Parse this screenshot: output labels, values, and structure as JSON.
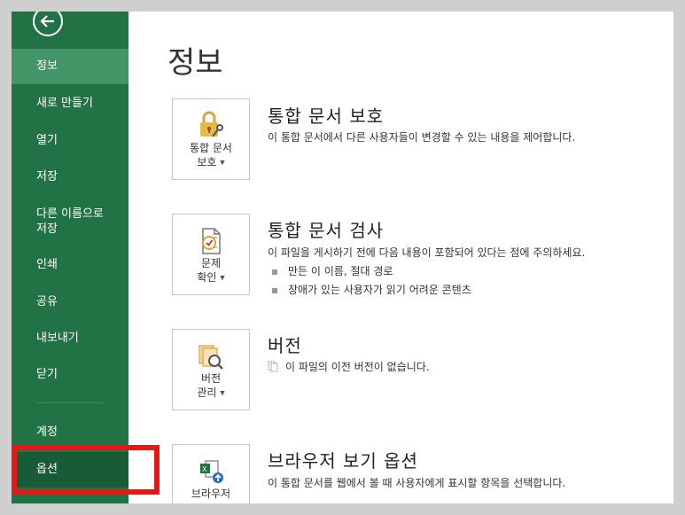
{
  "sidebar": {
    "items": [
      {
        "label": "정보"
      },
      {
        "label": "새로 만들기"
      },
      {
        "label": "열기"
      },
      {
        "label": "저장"
      },
      {
        "label": "다른 이름으로\n저장"
      },
      {
        "label": "인쇄"
      },
      {
        "label": "공유"
      },
      {
        "label": "내보내기"
      },
      {
        "label": "닫기"
      },
      {
        "label": "계정"
      },
      {
        "label": "옵션"
      }
    ]
  },
  "main": {
    "title": "정보",
    "sections": [
      {
        "button_label_1": "통합 문서",
        "button_label_2": "보호",
        "title": "통합 문서 보호",
        "desc": "이 통합 문서에서 다른 사용자들이 변경할 수 있는 내용을 제어합니다."
      },
      {
        "button_label_1": "문제",
        "button_label_2": "확인",
        "title": "통합 문서 검사",
        "desc": "이 파일을 게시하기 전에 다음 내용이 포함되어 있다는 점에 주의하세요.",
        "bullets": [
          "만든 이 이름, 절대 경로",
          "장애가 있는 사용자가 읽기 어려운 콘텐츠"
        ]
      },
      {
        "button_label_1": "버전",
        "button_label_2": "관리",
        "title": "버전",
        "desc": "이 파일의 이전 버전이 없습니다."
      },
      {
        "button_label_1": "브라우저",
        "title": "브라우저 보기 옵션",
        "desc": "이 통합 문서를 웹에서 볼 때 사용자에게 표시할 항목을 선택합니다."
      }
    ]
  },
  "colors": {
    "sidebar": "#217346",
    "active": "#439467",
    "highlight": "#e01919"
  }
}
